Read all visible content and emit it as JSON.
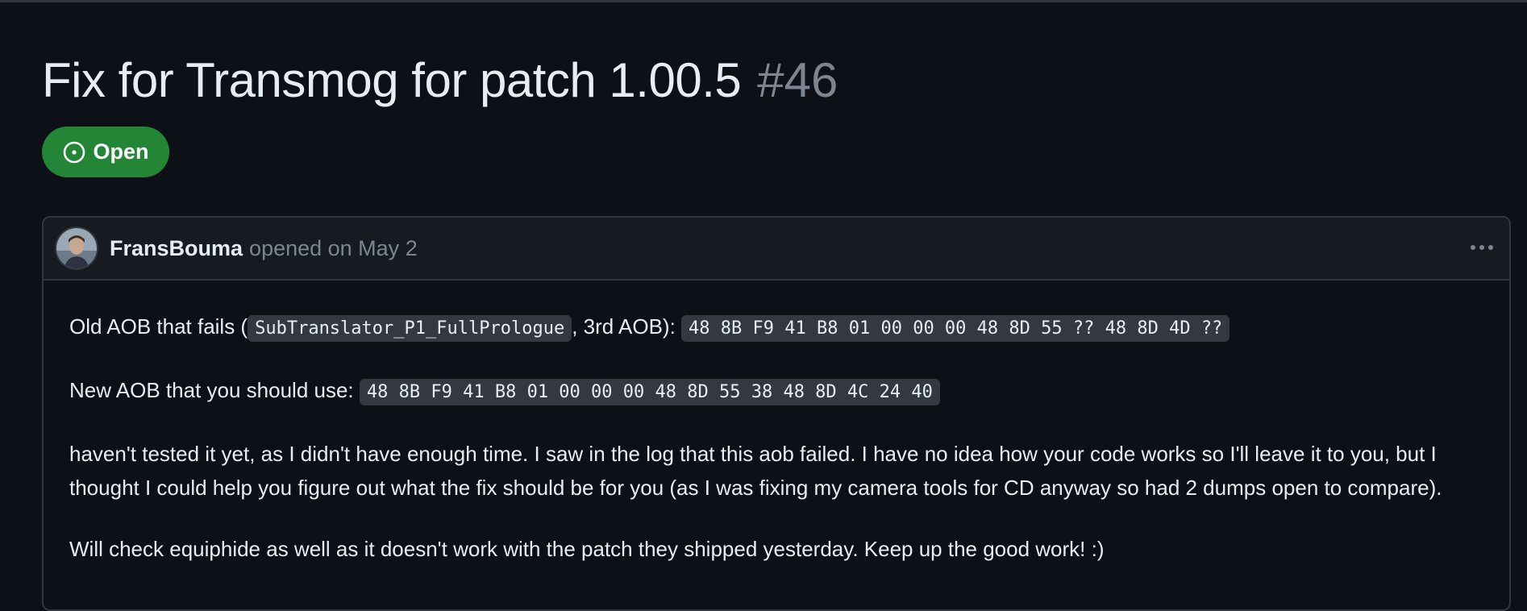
{
  "issue": {
    "title": "Fix for Transmog for patch 1.00.5",
    "number": "#46",
    "state": "Open",
    "state_color": "#238636"
  },
  "comment": {
    "author": "FransBouma",
    "meta": "opened on May 2",
    "avatar_icon": "user-avatar",
    "menu_icon": "kebab-horizontal-icon",
    "paragraphs": {
      "p1": {
        "pre": "Old AOB that fails (",
        "code1": "SubTranslator_P1_FullPrologue",
        "mid": ", 3rd AOB):",
        "code2": "48 8B F9 41 B8 01 00 00 00 48 8D 55 ?? 48 8D 4D ??"
      },
      "p2": {
        "pre": "New AOB that you should use:",
        "code": "48 8B F9 41 B8 01 00 00 00 48 8D 55 38 48 8D 4C 24 40"
      },
      "p3": "haven't tested it yet, as I didn't have enough time. I saw in the log that this aob failed. I have no idea how your code works so I'll leave it to you, but I thought I could help you figure out what the fix should be for you (as I was fixing my camera tools for CD anyway so had 2 dumps open to compare).",
      "p4": "Will check equiphide as well as it doesn't work with the patch they shipped yesterday. Keep up the good work! :)"
    }
  },
  "colors": {
    "background": "#0d1117",
    "header_background": "#161b22",
    "border": "#30363d",
    "muted_text": "#7d8590",
    "code_background": "#343941"
  }
}
